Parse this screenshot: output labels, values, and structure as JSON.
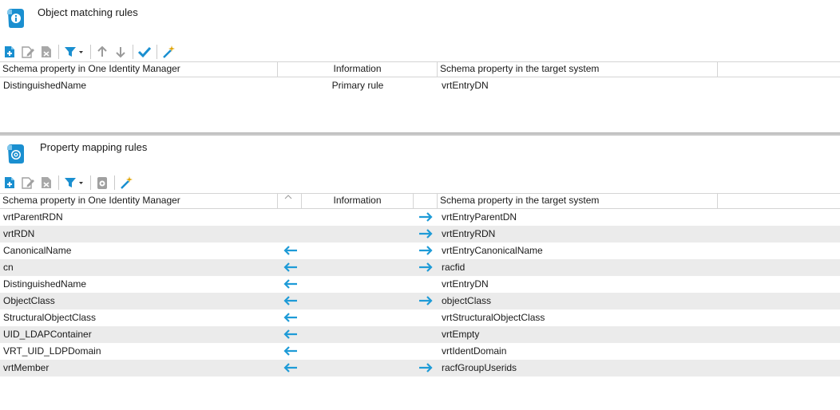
{
  "object_matching": {
    "title": "Object matching rules",
    "columns": {
      "left": "Schema property in One Identity Manager",
      "info": "Information",
      "right": "Schema property in the target system"
    },
    "rows": [
      {
        "left": "DistinguishedName",
        "info": "Primary rule",
        "right": "vrtEntryDN"
      }
    ]
  },
  "property_mapping": {
    "title": "Property mapping rules",
    "columns": {
      "left": "Schema property in One Identity Manager",
      "info": "Information",
      "right": "Schema property in the target system"
    },
    "rows": [
      {
        "left": "vrtParentRDN",
        "right": "vrtEntryParentDN",
        "to_left": false,
        "to_right": true
      },
      {
        "left": "vrtRDN",
        "right": "vrtEntryRDN",
        "to_left": false,
        "to_right": true
      },
      {
        "left": "CanonicalName",
        "right": "vrtEntryCanonicalName",
        "to_left": true,
        "to_right": true
      },
      {
        "left": "cn",
        "right": "racfid",
        "to_left": true,
        "to_right": true
      },
      {
        "left": "DistinguishedName",
        "right": "vrtEntryDN",
        "to_left": true,
        "to_right": false
      },
      {
        "left": "ObjectClass",
        "right": "objectClass",
        "to_left": true,
        "to_right": true
      },
      {
        "left": "StructuralObjectClass",
        "right": "vrtStructuralObjectClass",
        "to_left": true,
        "to_right": false
      },
      {
        "left": "UID_LDAPContainer",
        "right": "vrtEmpty",
        "to_left": true,
        "to_right": false
      },
      {
        "left": "VRT_UID_LDPDomain",
        "right": "vrtIdentDomain",
        "to_left": true,
        "to_right": false
      },
      {
        "left": "vrtMember",
        "right": "racfGroupUserids",
        "to_left": true,
        "to_right": true
      }
    ]
  },
  "toolbar1_icons": [
    "new-icon",
    "edit-icon",
    "delete-icon",
    "filter-icon",
    "move-up-icon",
    "move-down-icon",
    "apply-icon",
    "wizard-icon"
  ],
  "toolbar2_icons": [
    "new-icon",
    "edit-icon",
    "delete-icon",
    "filter-icon",
    "mapping-icon",
    "wizard-icon"
  ],
  "colors": {
    "arrow": "#1e9bd7",
    "alt_row": "#ebebeb",
    "accent": "#1a8fd0"
  }
}
